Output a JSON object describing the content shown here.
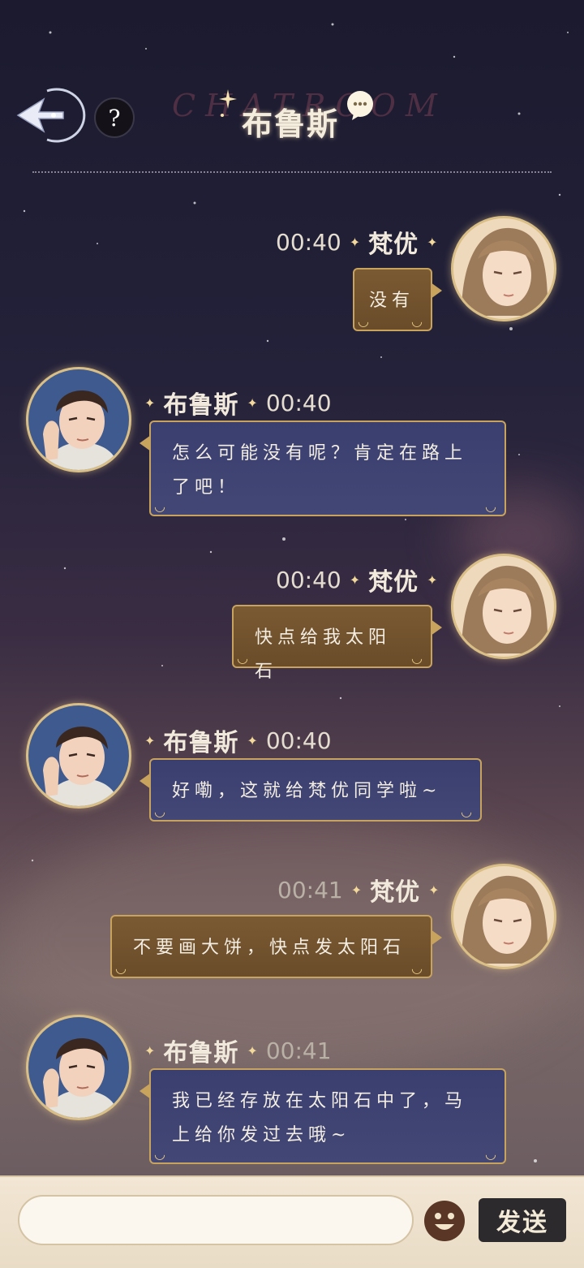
{
  "header": {
    "watermark": "CHATROOM",
    "title": "布鲁斯",
    "help_label": "?"
  },
  "messages": [
    {
      "side": "out",
      "name": "梵优",
      "time": "00:40",
      "text": "没有",
      "dim": false
    },
    {
      "side": "in",
      "name": "布鲁斯",
      "time": "00:40",
      "text": "怎么可能没有呢？肯定在路上了吧！",
      "dim": false
    },
    {
      "side": "out",
      "name": "梵优",
      "time": "00:40",
      "text": "快点给我太阳石",
      "dim": false
    },
    {
      "side": "in",
      "name": "布鲁斯",
      "time": "00:40",
      "text": "好嘞，这就给梵优同学啦~",
      "dim": false
    },
    {
      "side": "out",
      "name": "梵优",
      "time": "00:41",
      "text": "不要画大饼，快点发太阳石",
      "dim": true
    },
    {
      "side": "in",
      "name": "布鲁斯",
      "time": "00:41",
      "text": "我已经存放在太阳石中了，马上给你发过去哦~",
      "dim": true
    }
  ],
  "input": {
    "placeholder": "",
    "send_label": "发送"
  },
  "colors": {
    "bubble_out": "#7a5a32",
    "bubble_in": "#3a3f70",
    "border_gold": "#c8a35e"
  },
  "icons": {
    "back": "back-arrow-icon",
    "help": "question-icon",
    "chat": "speech-bubble-icon",
    "emoji": "smiley-face-icon"
  }
}
